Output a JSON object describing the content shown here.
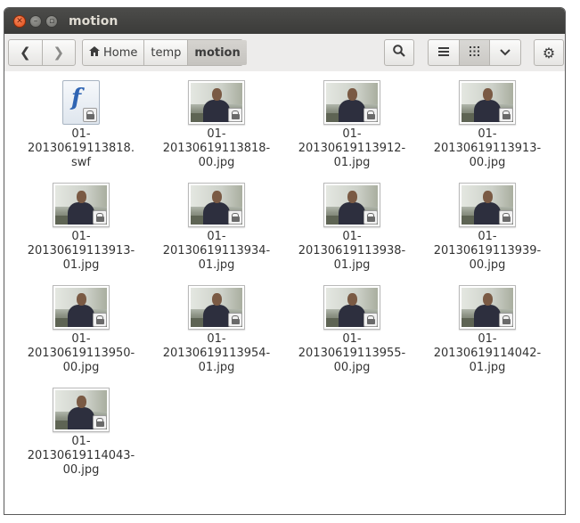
{
  "window": {
    "title": "motion"
  },
  "toolbar": {
    "back_icon": "chevron-left-icon",
    "forward_icon": "chevron-right-icon",
    "breadcrumbs": [
      {
        "label": "Home",
        "icon": "home-icon"
      },
      {
        "label": "temp"
      },
      {
        "label": "motion",
        "active": true
      }
    ],
    "search_icon": "search-icon",
    "view_list_icon": "list-view-icon",
    "view_grid_icon": "grid-view-icon",
    "view_menu_icon": "chevron-down-icon",
    "settings_icon": "gear-icon"
  },
  "files": [
    {
      "line1": "01-",
      "line2": "20130619113818.",
      "line3": "swf",
      "type": "swf"
    },
    {
      "line1": "01-",
      "line2": "20130619113818-",
      "line3": "00.jpg",
      "type": "jpg"
    },
    {
      "line1": "01-",
      "line2": "20130619113912-",
      "line3": "01.jpg",
      "type": "jpg"
    },
    {
      "line1": "01-",
      "line2": "20130619113913-",
      "line3": "00.jpg",
      "type": "jpg"
    },
    {
      "line1": "01-",
      "line2": "20130619113913-",
      "line3": "01.jpg",
      "type": "jpg"
    },
    {
      "line1": "01-",
      "line2": "20130619113934-",
      "line3": "01.jpg",
      "type": "jpg"
    },
    {
      "line1": "01-",
      "line2": "20130619113938-",
      "line3": "01.jpg",
      "type": "jpg"
    },
    {
      "line1": "01-",
      "line2": "20130619113939-",
      "line3": "00.jpg",
      "type": "jpg"
    },
    {
      "line1": "01-",
      "line2": "20130619113950-",
      "line3": "00.jpg",
      "type": "jpg"
    },
    {
      "line1": "01-",
      "line2": "20130619113954-",
      "line3": "01.jpg",
      "type": "jpg"
    },
    {
      "line1": "01-",
      "line2": "20130619113955-",
      "line3": "00.jpg",
      "type": "jpg"
    },
    {
      "line1": "01-",
      "line2": "20130619114042-",
      "line3": "01.jpg",
      "type": "jpg"
    },
    {
      "line1": "01-",
      "line2": "20130619114043-",
      "line3": "00.jpg",
      "type": "jpg"
    }
  ]
}
